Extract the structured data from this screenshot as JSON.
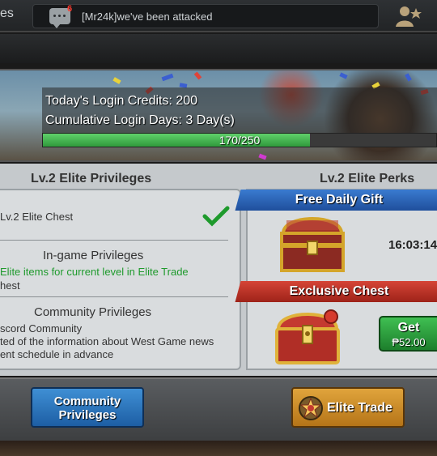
{
  "topbar": {
    "tab_fragment": "es",
    "chat_badge": "6",
    "chat_message": "[Mr24k]we've been attacked"
  },
  "banner": {
    "login_credits": "Today's Login Credits: 200",
    "login_days": "Cumulative Login Days: 3 Day(s)",
    "progress_text": "170/250",
    "progress_value": 170,
    "progress_max": 250
  },
  "privileges": {
    "heading": "Lv.2 Elite Privileges",
    "chest_label": "Lv.2 Elite Chest",
    "ingame_heading": "In-game Privileges",
    "ingame_line1": "Elite items for current level in Elite Trade",
    "ingame_line2": "hest",
    "community_heading": "Community Privileges",
    "community_line1": "scord Community",
    "community_line2": "ted of the information about West Game news",
    "community_line3": "ent schedule in advance"
  },
  "perks": {
    "heading": "Lv.2 Elite Perks",
    "free_gift_label": "Free Daily Gift",
    "timer": "16:03:14",
    "exclusive_label": "Exclusive Chest",
    "get_label": "Get",
    "price": "₱52.00"
  },
  "buttons": {
    "community_line1": "Community",
    "community_line2": "Privileges",
    "elite_trade": "Elite Trade"
  },
  "colors": {
    "accent_green": "#1e9a2c",
    "ribbon_blue": "#2a63b8",
    "ribbon_red": "#c2342a",
    "button_gold": "#d08f2e"
  }
}
